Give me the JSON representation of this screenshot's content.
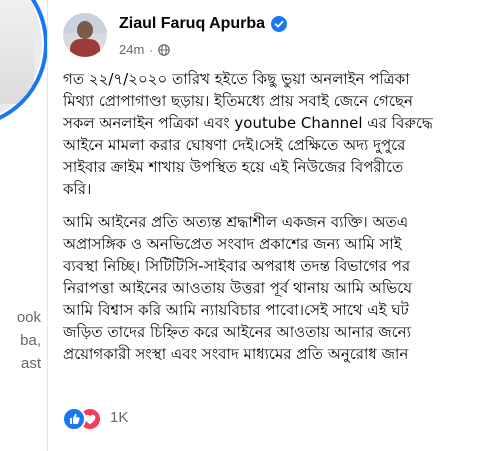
{
  "left_panel": {
    "text_lines": [
      "ook",
      "ba,",
      "ast"
    ]
  },
  "post": {
    "author": {
      "name": "Ziaul Faruq Apurba",
      "verified": true
    },
    "timestamp": "24m",
    "audience_icon": "globe-icon",
    "paragraphs": [
      {
        "lines": [
          "গত ২২/৭/২০২০ তারিখ হইতে কিছু ভুয়া অনলাইন পত্রিকা",
          "মিথ্যা প্রোপাগাণ্ডা ছড়ায়। ইতিমধ্যে প্রায় সবাই জেনে গেছেন",
          "সকল অনলাইন পত্রিকা এবং youtube Channel এর বিরুদ্ধে",
          "আইনে মামলা করার ঘোষণা দেই।সেই প্রেক্ষিতে অদ্য দুপুরে",
          "সাইবার ক্রাইম শাখায় উপস্থিত হয়ে এই নিউজের বিপরীতে",
          "করি।"
        ]
      },
      {
        "lines": [
          "আমি আইনের প্রতি অত্যন্ত শ্রদ্ধাশীল একজন ব্যক্তি। অতএ",
          "অপ্রাসঙ্গিক ও অনভিপ্রেত সংবাদ প্রকাশের জন্য আমি সাই",
          "ব্যবস্থা নিচ্ছি। সিটিটিসি-সাইবার অপরাধ তদন্ত বিভাগের পর",
          "নিরাপত্তা আইনের আওতায় উত্তরা পূর্ব থানায় আমি অভিযে",
          "আমি বিশ্বাস করি আমি ন্যায়বিচার পাবো।সেই সাথে এই ঘট",
          "জড়িত তাদের চিহ্নিত করে আইনের আওতায় আনার জন্যে",
          "প্রয়োগকারী সংস্থা এবং সংবাদ মাধ্যমের প্রতি অনুরোধ জান"
        ]
      }
    ],
    "reactions": {
      "types": [
        "like-icon",
        "love-icon"
      ],
      "count": "1K"
    }
  },
  "colors": {
    "accent": "#1877f2",
    "love": "#f33e58",
    "secondary_text": "#65676b",
    "primary_text": "#050505"
  }
}
